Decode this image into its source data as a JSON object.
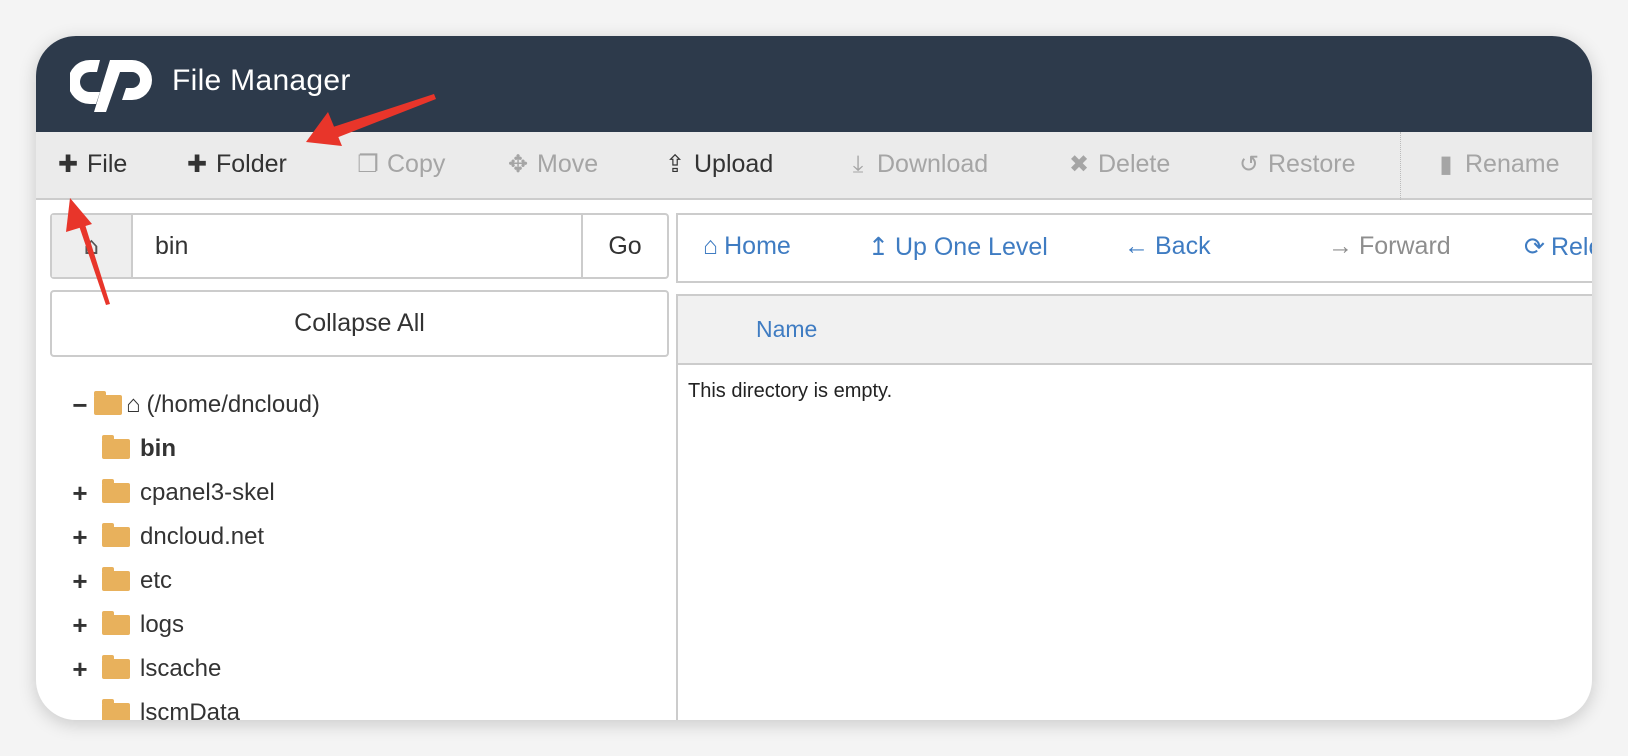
{
  "header": {
    "title": "File Manager",
    "logo_text": "cP",
    "bg": "#2d3a4b"
  },
  "toolbar": {
    "items": [
      {
        "label": "File",
        "icon": "plus-icon",
        "enabled": true
      },
      {
        "label": "Folder",
        "icon": "plus-icon",
        "enabled": true
      },
      {
        "label": "Copy",
        "icon": "copy-icon",
        "enabled": false
      },
      {
        "label": "Move",
        "icon": "move-icon",
        "enabled": false
      },
      {
        "label": "Upload",
        "icon": "upload-icon",
        "enabled": true
      },
      {
        "label": "Download",
        "icon": "download-icon",
        "enabled": false
      },
      {
        "label": "Delete",
        "icon": "delete-icon",
        "enabled": false
      },
      {
        "label": "Restore",
        "icon": "restore-icon",
        "enabled": false
      },
      {
        "label": "Rename",
        "icon": "file-icon",
        "enabled": false
      }
    ]
  },
  "path": {
    "value": "bin",
    "go_label": "Go"
  },
  "collapse_label": "Collapse All",
  "tree": {
    "root": "(/home/dncloud)",
    "items": [
      {
        "name": "bin",
        "expandable": false,
        "selected": true
      },
      {
        "name": "cpanel3-skel",
        "expandable": true
      },
      {
        "name": "dncloud.net",
        "expandable": true
      },
      {
        "name": "etc",
        "expandable": true
      },
      {
        "name": "logs",
        "expandable": true
      },
      {
        "name": "lscache",
        "expandable": true
      },
      {
        "name": "lscmData",
        "expandable": false
      }
    ]
  },
  "nav": {
    "home": "Home",
    "up": "Up One Level",
    "back": "Back",
    "forward": "Forward",
    "reload": "Reloa"
  },
  "table": {
    "column": "Name",
    "empty_message": "This directory is empty."
  },
  "colors": {
    "accent": "#3f7cc2",
    "folder": "#e8b15c",
    "annotation_arrow": "#e8352a"
  }
}
